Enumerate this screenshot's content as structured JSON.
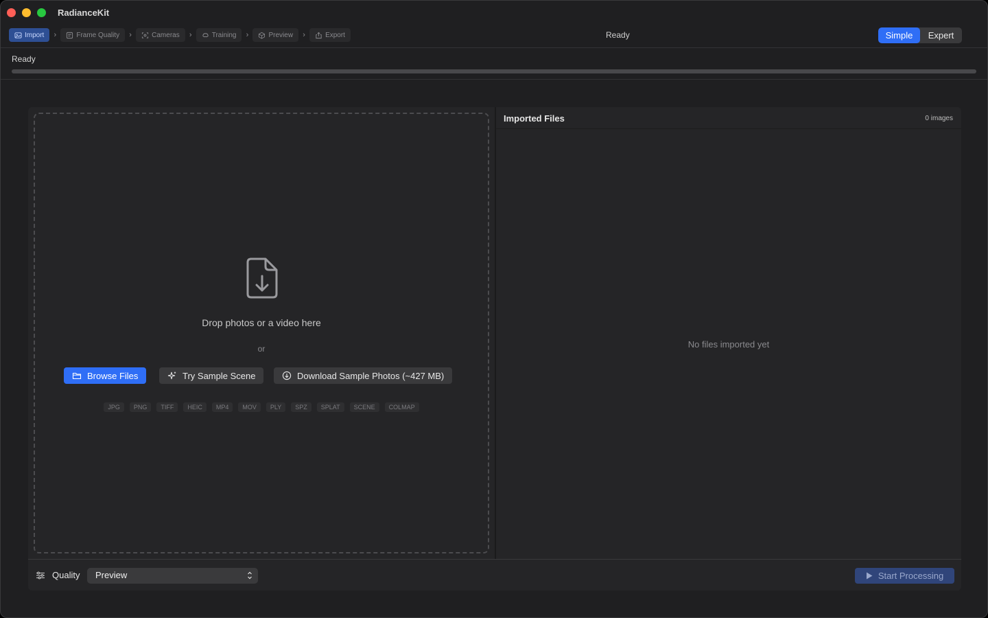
{
  "window": {
    "title": "RadianceKit"
  },
  "toolbar": {
    "steps": [
      {
        "label": "Import",
        "icon": "import-icon",
        "active": true
      },
      {
        "label": "Frame Quality",
        "icon": "frame-quality-icon",
        "active": false
      },
      {
        "label": "Cameras",
        "icon": "cameras-icon",
        "active": false
      },
      {
        "label": "Training",
        "icon": "training-icon",
        "active": false
      },
      {
        "label": "Preview",
        "icon": "preview-icon",
        "active": false
      },
      {
        "label": "Export",
        "icon": "export-icon",
        "active": false
      }
    ],
    "status": "Ready",
    "mode": {
      "options": [
        "Simple",
        "Expert"
      ],
      "selected": "Simple"
    }
  },
  "status_area": {
    "label": "Ready",
    "progress": 0
  },
  "dropzone": {
    "icon": "document-download-icon",
    "prompt": "Drop photos or a video here",
    "or": "or",
    "buttons": {
      "browse": "Browse Files",
      "sample": "Try Sample Scene",
      "download": "Download Sample Photos (~427 MB)"
    },
    "formats": [
      "JPG",
      "PNG",
      "TIFF",
      "HEIC",
      "MP4",
      "MOV",
      "PLY",
      "SPZ",
      "SPLAT",
      "SCENE",
      "COLMAP"
    ]
  },
  "files_panel": {
    "title": "Imported Files",
    "count": "0 images",
    "empty": "No files imported yet"
  },
  "bottom": {
    "quality_label": "Quality",
    "quality_value": "Preview",
    "start": "Start Processing"
  },
  "colors": {
    "accent": "#2f6ef6",
    "active_step": "#2e4f94",
    "background": "#1f1f21",
    "panel": "#252527"
  }
}
